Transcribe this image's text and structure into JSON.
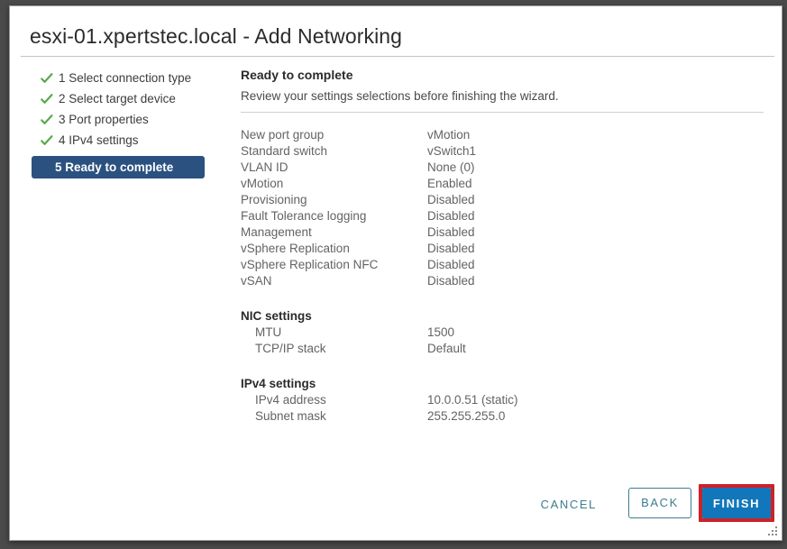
{
  "window": {
    "title": "esxi-01.xpertstec.local - Add Networking",
    "resize_grip_icon": "resize-grip-icon"
  },
  "steps": [
    {
      "number": "1",
      "label": "1 Select connection type",
      "state": "done",
      "icon": "check-icon"
    },
    {
      "number": "2",
      "label": "2 Select target device",
      "state": "done",
      "icon": "check-icon"
    },
    {
      "number": "3",
      "label": "3 Port properties",
      "state": "done",
      "icon": "check-icon"
    },
    {
      "number": "4",
      "label": "4 IPv4 settings",
      "state": "done",
      "icon": "check-icon"
    },
    {
      "number": "5",
      "label": "5 Ready to complete",
      "state": "active",
      "icon": ""
    }
  ],
  "panel": {
    "heading": "Ready to complete",
    "subheading": "Review your settings selections before finishing the wizard."
  },
  "summary": {
    "main_rows": [
      {
        "label": "New port group",
        "value": "vMotion"
      },
      {
        "label": "Standard switch",
        "value": "vSwitch1"
      },
      {
        "label": "VLAN ID",
        "value": "None (0)"
      },
      {
        "label": "vMotion",
        "value": "Enabled"
      },
      {
        "label": "Provisioning",
        "value": "Disabled"
      },
      {
        "label": "Fault Tolerance logging",
        "value": "Disabled"
      },
      {
        "label": "Management",
        "value": "Disabled"
      },
      {
        "label": "vSphere Replication",
        "value": "Disabled"
      },
      {
        "label": "vSphere Replication NFC",
        "value": "Disabled"
      },
      {
        "label": "vSAN",
        "value": "Disabled"
      }
    ],
    "nic": {
      "title": "NIC settings",
      "rows": [
        {
          "label": "MTU",
          "value": "1500"
        },
        {
          "label": "TCP/IP stack",
          "value": "Default"
        }
      ]
    },
    "ipv4": {
      "title": "IPv4 settings",
      "rows": [
        {
          "label": "IPv4 address",
          "value": "10.0.0.51 (static)"
        },
        {
          "label": "Subnet mask",
          "value": "255.255.255.0"
        }
      ]
    }
  },
  "footer": {
    "cancel_label": "CANCEL",
    "back_label": "BACK",
    "finish_label": "FINISH"
  },
  "colors": {
    "active_step_bg": "#2b5180",
    "check_green": "#5aa84f",
    "link_teal": "#3d7d8e",
    "finish_blue": "#1177ba",
    "highlight_red": "#cc2229"
  }
}
